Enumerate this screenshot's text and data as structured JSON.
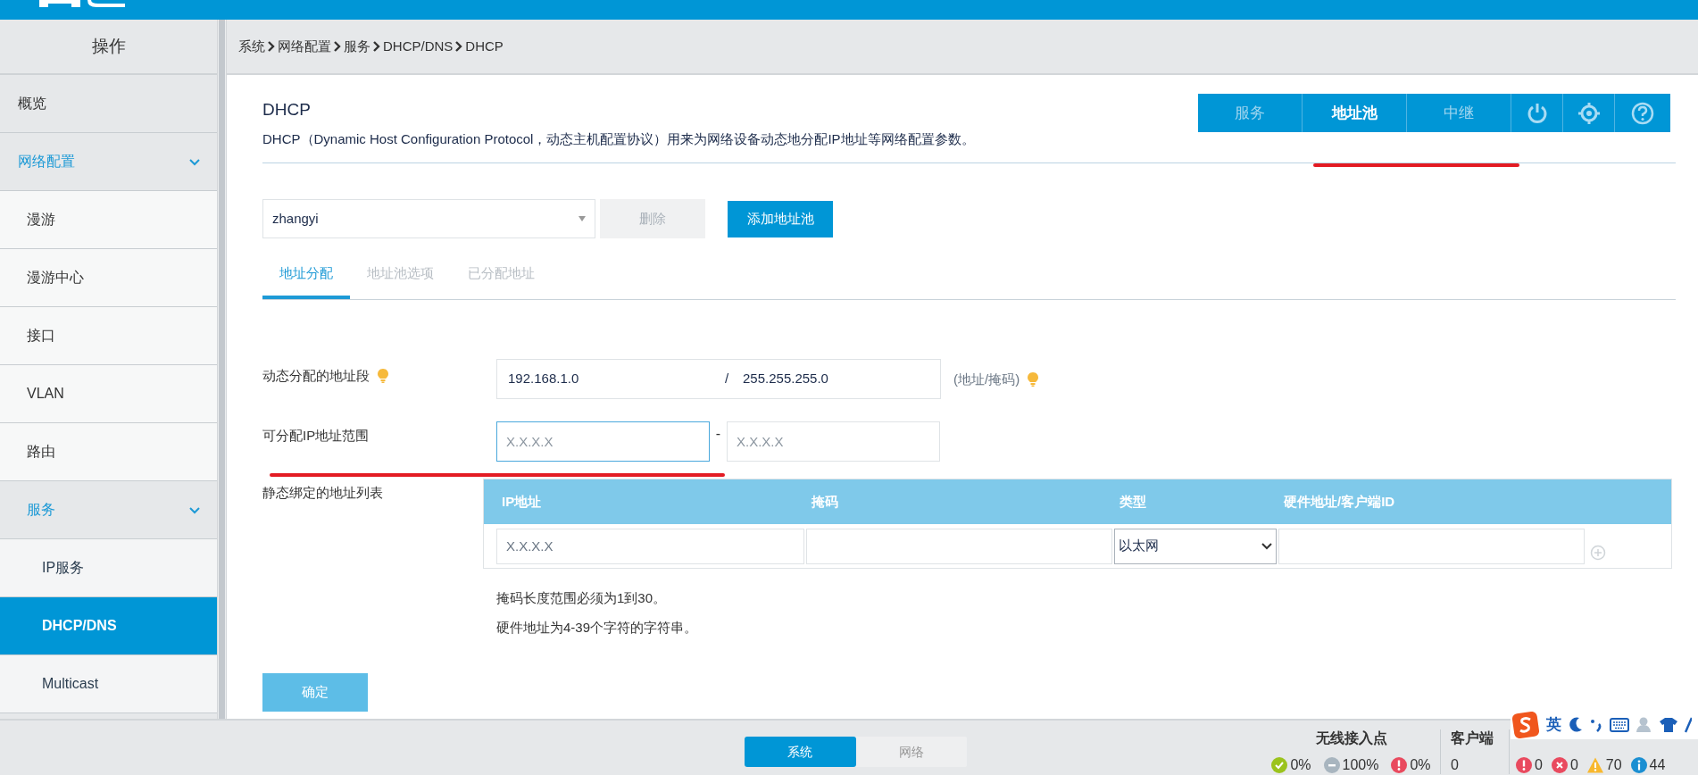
{
  "breadcrumb": [
    "系统",
    "网络配置",
    "服务",
    "DHCP/DNS",
    "DHCP"
  ],
  "sidebar": {
    "header": "操作",
    "items": [
      {
        "label": "概览",
        "kind": "item",
        "selected": false
      },
      {
        "label": "网络配置",
        "kind": "group",
        "expanded": true,
        "selected": false,
        "children": [
          {
            "label": "漫游",
            "kind": "item",
            "selected": false
          },
          {
            "label": "漫游中心",
            "kind": "item",
            "selected": false
          },
          {
            "label": "接口",
            "kind": "item",
            "selected": false
          },
          {
            "label": "VLAN",
            "kind": "item",
            "selected": false
          },
          {
            "label": "路由",
            "kind": "item",
            "selected": false
          },
          {
            "label": "服务",
            "kind": "group",
            "expanded": true,
            "selected": false,
            "children": [
              {
                "label": "IP服务",
                "kind": "item",
                "selected": false
              },
              {
                "label": "DHCP/DNS",
                "kind": "item",
                "selected": true
              },
              {
                "label": "Multicast",
                "kind": "item",
                "selected": false
              }
            ]
          }
        ]
      }
    ]
  },
  "page": {
    "title": "DHCP",
    "description": "DHCP（Dynamic Host Configuration Protocol，动态主机配置协议）用来为网络设备动态地分配IP地址等网络配置参数。"
  },
  "top_tabs": [
    {
      "label": "服务",
      "selected": false
    },
    {
      "label": "地址池",
      "selected": true
    },
    {
      "label": "中继",
      "selected": false
    }
  ],
  "pool": {
    "value": "zhangyi",
    "delete_button": {
      "label": "删除",
      "disabled": true
    },
    "add_button": "添加地址池"
  },
  "sub_tabs": [
    {
      "label": "地址分配",
      "selected": true
    },
    {
      "label": "地址池选项",
      "selected": false
    },
    {
      "label": "已分配地址",
      "selected": false
    }
  ],
  "address_segment": {
    "label": "动态分配的地址段",
    "address": "192.168.1.0",
    "separator": "/",
    "mask": "255.255.255.0",
    "hint": "(地址/掩码)"
  },
  "range": {
    "label": "可分配IP地址范围",
    "start": {
      "placeholder": "X.X.X.X",
      "focused": true
    },
    "separator": "-",
    "end": {
      "placeholder": "X.X.X.X",
      "focused": false
    }
  },
  "static_bindings": {
    "label": "静态绑定的地址列表",
    "columns": [
      "IP地址",
      "掩码",
      "类型",
      "硬件地址/客户端ID"
    ],
    "row": {
      "ip_placeholder": "X.X.X.X",
      "type": "以太网"
    }
  },
  "notes": [
    "掩码长度范围必须为1到30。",
    "硬件地址为4-39个字符的字符串。"
  ],
  "confirm_button": {
    "label": "确定",
    "disabled": true
  },
  "bottom_toggle": [
    {
      "label": "系统",
      "selected": true
    },
    {
      "label": "网络",
      "selected": false
    }
  ],
  "ap_stats": {
    "title": "无线接入点",
    "items": [
      {
        "kind": "ok",
        "value": "0%"
      },
      {
        "kind": "offline",
        "value": "100%"
      },
      {
        "kind": "error",
        "value": "0%"
      }
    ]
  },
  "clients": {
    "title": "客户端",
    "value": "0"
  },
  "alarms": {
    "items": [
      {
        "kind": "error",
        "value": "0"
      },
      {
        "kind": "critical",
        "value": "0"
      },
      {
        "kind": "warning",
        "value": "70"
      },
      {
        "kind": "info",
        "value": "44"
      }
    ]
  },
  "ime": {
    "language": "英"
  }
}
